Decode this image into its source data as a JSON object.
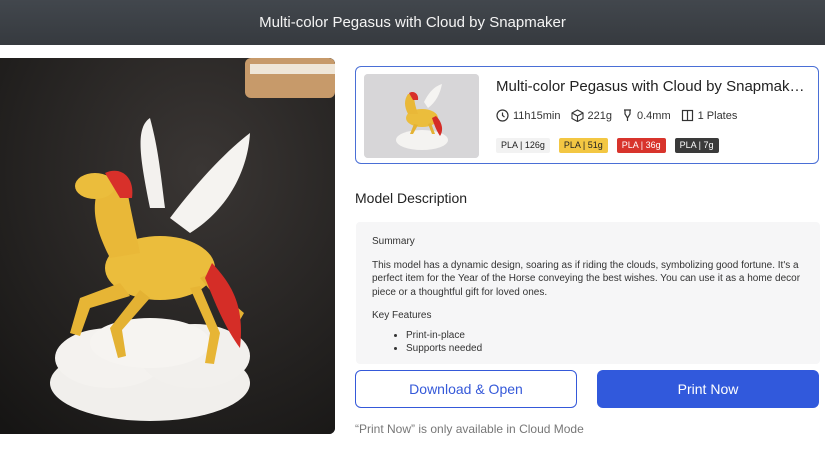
{
  "window": {
    "title": "Multi-color Pegasus with Cloud by Snapmaker"
  },
  "model_card": {
    "title": "Multi-color Pegasus with Cloud by Snapmaker_...",
    "stats": {
      "time": "11h15min",
      "weight": "221g",
      "nozzle": "0.4mm",
      "plates": "1 Plates"
    },
    "filaments": [
      {
        "label": "PLA | 126g",
        "bg": "#f2f2f2",
        "fg": "#222222"
      },
      {
        "label": "PLA | 51g",
        "bg": "#f3c743",
        "fg": "#222222"
      },
      {
        "label": "PLA | 36g",
        "bg": "#d8342c",
        "fg": "#ffffff"
      },
      {
        "label": "PLA | 7g",
        "bg": "#3a3a3a",
        "fg": "#ffffff"
      }
    ]
  },
  "description": {
    "heading": "Model Description",
    "summary_label": "Summary",
    "summary_text": "This model has a dynamic design, soaring as if riding the clouds, symbolizing good fortune. It's a perfect item for the Year of the Horse conveying the best wishes. You can use it as a home decor piece or a thoughtful gift for loved ones.",
    "features_label": "Key Features",
    "features": [
      "Print-in-place",
      "Supports needed"
    ]
  },
  "actions": {
    "download_label": "Download & Open",
    "print_label": "Print Now",
    "note": "“Print Now” is only available in Cloud Mode"
  },
  "colors": {
    "accent": "#3159dc",
    "titlebar": "#3b3f44"
  },
  "icons": [
    "clock-icon",
    "weight-cube-icon",
    "nozzle-icon",
    "plates-icon"
  ]
}
